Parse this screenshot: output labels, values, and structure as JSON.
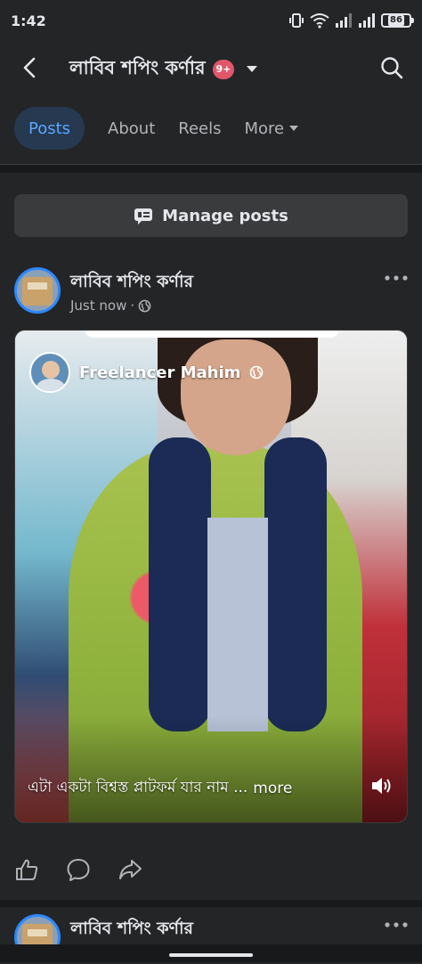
{
  "status_bar": {
    "time": "1:42",
    "battery": "86"
  },
  "header": {
    "page_name": "লাবিব শপিং কর্ণার",
    "notification_badge": "9+"
  },
  "tabs": [
    {
      "label": "Posts",
      "active": true
    },
    {
      "label": "About",
      "active": false
    },
    {
      "label": "Reels",
      "active": false
    },
    {
      "label": "More",
      "active": false
    }
  ],
  "manage_posts": {
    "label": "Manage posts"
  },
  "post": {
    "author": "লাবিব শপিং কর্ণার",
    "timestamp": "Just now",
    "separator": "·",
    "video": {
      "creator": "Freelancer Mahim",
      "caption": "এটা একটা বিশ্বস্ত প্লাটফর্ম যার নাম ...",
      "more_label": "more"
    }
  },
  "post2": {
    "author": "লাবিব শপিং কর্ণার"
  },
  "icons": {
    "back": "back-arrow-icon",
    "search": "search-icon",
    "globe": "globe-icon",
    "like": "like-icon",
    "comment": "comment-icon",
    "share": "share-icon",
    "volume": "volume-icon"
  },
  "colors": {
    "accent": "#5aa7ff",
    "active_tab_bg": "#263951",
    "badge": "#e0566a",
    "background": "#242526"
  }
}
